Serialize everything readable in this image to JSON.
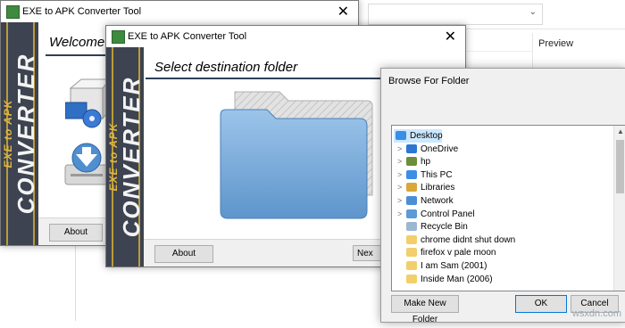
{
  "explorer": {
    "preview_label": "Preview"
  },
  "window_back": {
    "title": "EXE to APK Converter Tool",
    "close": "✕",
    "logo_small": "EXE to APK",
    "logo_big": "CONVERTER",
    "heading": "Welcome",
    "about_label": "About"
  },
  "window_front": {
    "title": "EXE to APK Converter Tool",
    "close": "✕",
    "logo_small": "EXE to APK",
    "logo_big": "CONVERTER",
    "heading": "Select destination folder",
    "about_label": "About",
    "next_label": "Nex"
  },
  "browse_dialog": {
    "title": "Browse For Folder",
    "tree": [
      {
        "label": "Desktop",
        "icon": "desktop-icon",
        "expander": "",
        "selected": true
      },
      {
        "label": "OneDrive",
        "icon": "cloud-icon",
        "expander": ">"
      },
      {
        "label": "hp",
        "icon": "user-icon",
        "expander": ">"
      },
      {
        "label": "This PC",
        "icon": "computer-icon",
        "expander": ">"
      },
      {
        "label": "Libraries",
        "icon": "library-icon",
        "expander": ">"
      },
      {
        "label": "Network",
        "icon": "network-icon",
        "expander": ">"
      },
      {
        "label": "Control Panel",
        "icon": "control-panel-icon",
        "expander": ">"
      },
      {
        "label": "Recycle Bin",
        "icon": "recycle-bin-icon",
        "expander": ""
      },
      {
        "label": "chrome didnt shut down",
        "icon": "folder-icon",
        "expander": ""
      },
      {
        "label": "firefox v pale moon",
        "icon": "folder-icon",
        "expander": ""
      },
      {
        "label": "I am Sam (2001)",
        "icon": "folder-icon",
        "expander": ""
      },
      {
        "label": "Inside Man (2006)",
        "icon": "folder-icon",
        "expander": ""
      }
    ],
    "make_new_folder_label": "Make New Folder",
    "ok_label": "OK",
    "cancel_label": "Cancel"
  },
  "watermark": "wsxdn.com",
  "colors": {
    "sidebar_bg": "#3d4350",
    "logo_gold": "#e0b640",
    "selection_blue": "#cce8ff",
    "folder_blue": "#6fa6d6"
  }
}
